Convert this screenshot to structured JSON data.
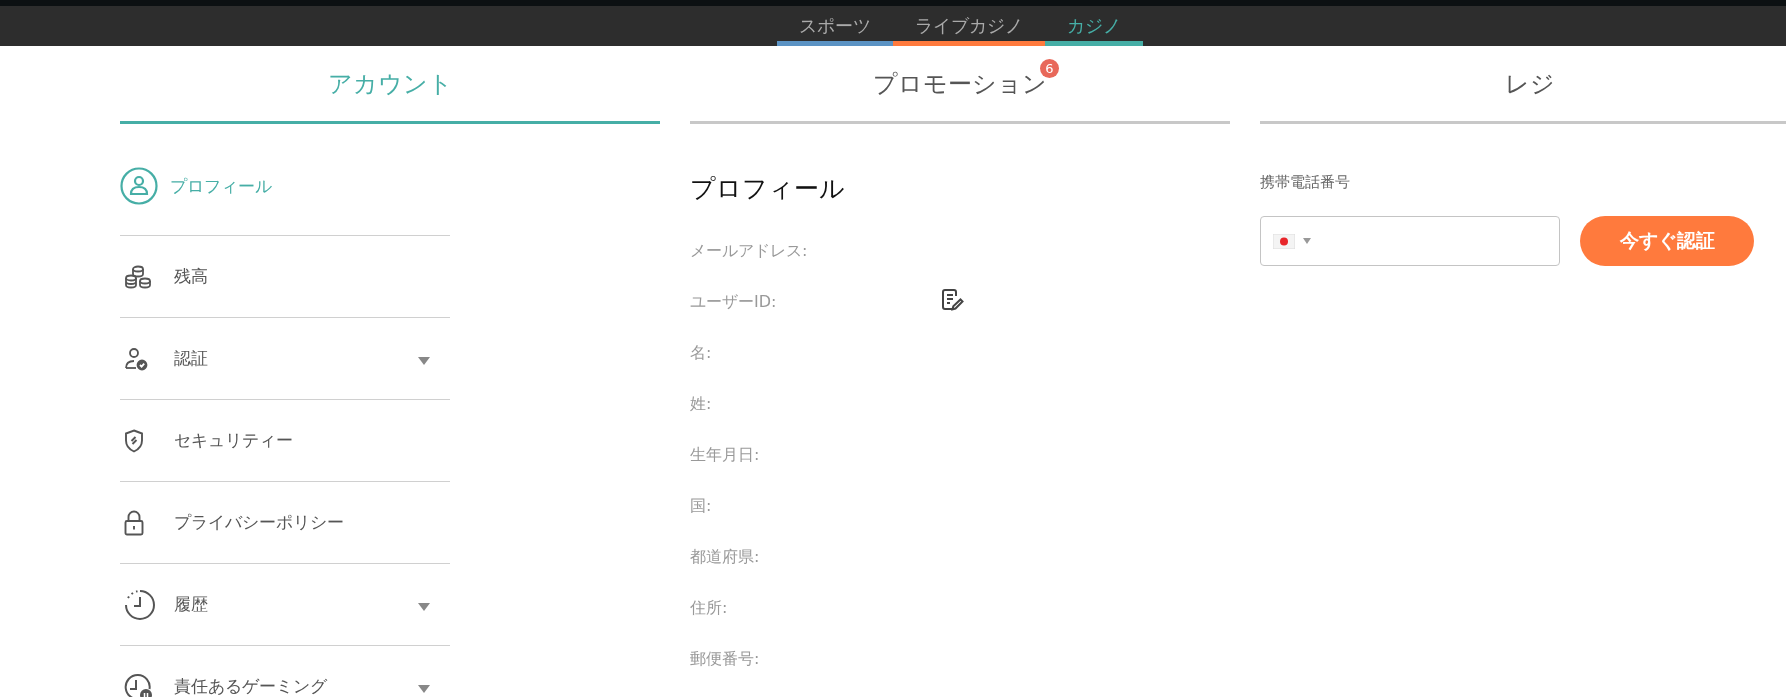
{
  "product_tabs": [
    {
      "label": "スポーツ",
      "selected": false,
      "color": "#5b93c4"
    },
    {
      "label": "ライブカジノ",
      "selected": false,
      "color": "#ff7a3d"
    },
    {
      "label": "カジノ",
      "selected": true,
      "color": "#46aea6"
    }
  ],
  "main_tabs": [
    {
      "label": "アカウント",
      "selected": true
    },
    {
      "label": "プロモーション",
      "selected": false,
      "badge": "6"
    },
    {
      "label": "レジ",
      "selected": false
    }
  ],
  "sidebar": {
    "items": [
      {
        "kind": "profile",
        "label": "プロフィール",
        "selected": true,
        "expandable": false
      },
      {
        "kind": "balance",
        "label": "残高",
        "selected": false,
        "expandable": false
      },
      {
        "kind": "verification",
        "label": "認証",
        "selected": false,
        "expandable": true
      },
      {
        "kind": "security",
        "label": "セキュリティー",
        "selected": false,
        "expandable": false
      },
      {
        "kind": "privacy",
        "label": "プライバシーポリシー",
        "selected": false,
        "expandable": false
      },
      {
        "kind": "history",
        "label": "履歴",
        "selected": false,
        "expandable": true
      },
      {
        "kind": "responsible",
        "label": "責任あるゲーミング",
        "selected": false,
        "expandable": true
      }
    ]
  },
  "profile": {
    "title": "プロフィール",
    "fields": [
      {
        "label": "メールアドレス:",
        "editable": false
      },
      {
        "label": "ユーザーID:",
        "editable": true
      },
      {
        "label": "名:",
        "editable": false
      },
      {
        "label": "姓:",
        "editable": false
      },
      {
        "label": "生年月日:",
        "editable": false
      },
      {
        "label": "国:",
        "editable": false
      },
      {
        "label": "都道府県:",
        "editable": false
      },
      {
        "label": "住所:",
        "editable": false
      },
      {
        "label": "郵便番号:",
        "editable": false
      }
    ]
  },
  "phone": {
    "label": "携帯電話番号",
    "button": "今すぐ認証"
  }
}
